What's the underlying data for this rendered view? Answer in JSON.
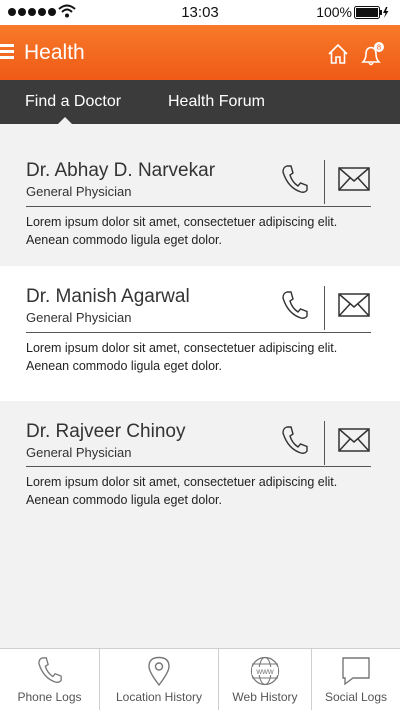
{
  "status_bar": {
    "time": "13:03",
    "battery": "100%"
  },
  "header": {
    "title": "Health",
    "notification_count": "8"
  },
  "tabs": [
    {
      "label": "Find a Doctor"
    },
    {
      "label": "Health Forum"
    }
  ],
  "doctors": [
    {
      "name": "Dr. Abhay D. Narvekar",
      "specialty": "General Physician",
      "description_line1": "Lorem ipsum dolor sit amet, consectetuer adipiscing elit.",
      "description_line2": "Aenean commodo ligula eget dolor."
    },
    {
      "name": "Dr. Manish Agarwal",
      "specialty": "General Physician",
      "description_line1": "Lorem ipsum dolor sit amet, consectetuer adipiscing elit.",
      "description_line2": "Aenean commodo ligula eget dolor."
    },
    {
      "name": "Dr. Rajveer Chinoy",
      "specialty": "General Physician",
      "description_line1": "Lorem ipsum dolor sit amet, consectetuer adipiscing elit.",
      "description_line2": "Aenean commodo ligula eget dolor."
    }
  ],
  "bottom_nav": [
    {
      "label": "Phone Logs"
    },
    {
      "label": "Location History"
    },
    {
      "label": "Web History"
    },
    {
      "label": "Social Logs"
    }
  ],
  "colors": {
    "header_orange": "#f26a1f",
    "tab_bar": "#3b3b3b"
  }
}
